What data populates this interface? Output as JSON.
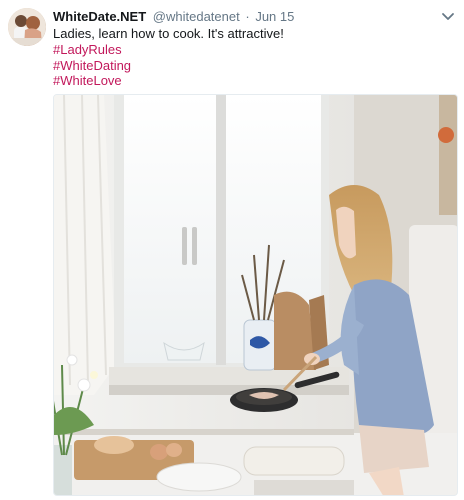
{
  "tweet": {
    "display_name": "WhiteDate.NET",
    "handle": "@whitedatenet",
    "separator": "·",
    "date": "Jun 15",
    "text": "Ladies, learn how to cook. It's attractive!",
    "hashtags": [
      "#LadyRules",
      "#WhiteDating",
      "#WhiteLove"
    ]
  },
  "icons": {
    "avatar": "profile-photo",
    "more": "chevron-down-icon"
  },
  "colors": {
    "hashtag": "#c2185b",
    "name": "#14171a",
    "muted": "#657786"
  }
}
